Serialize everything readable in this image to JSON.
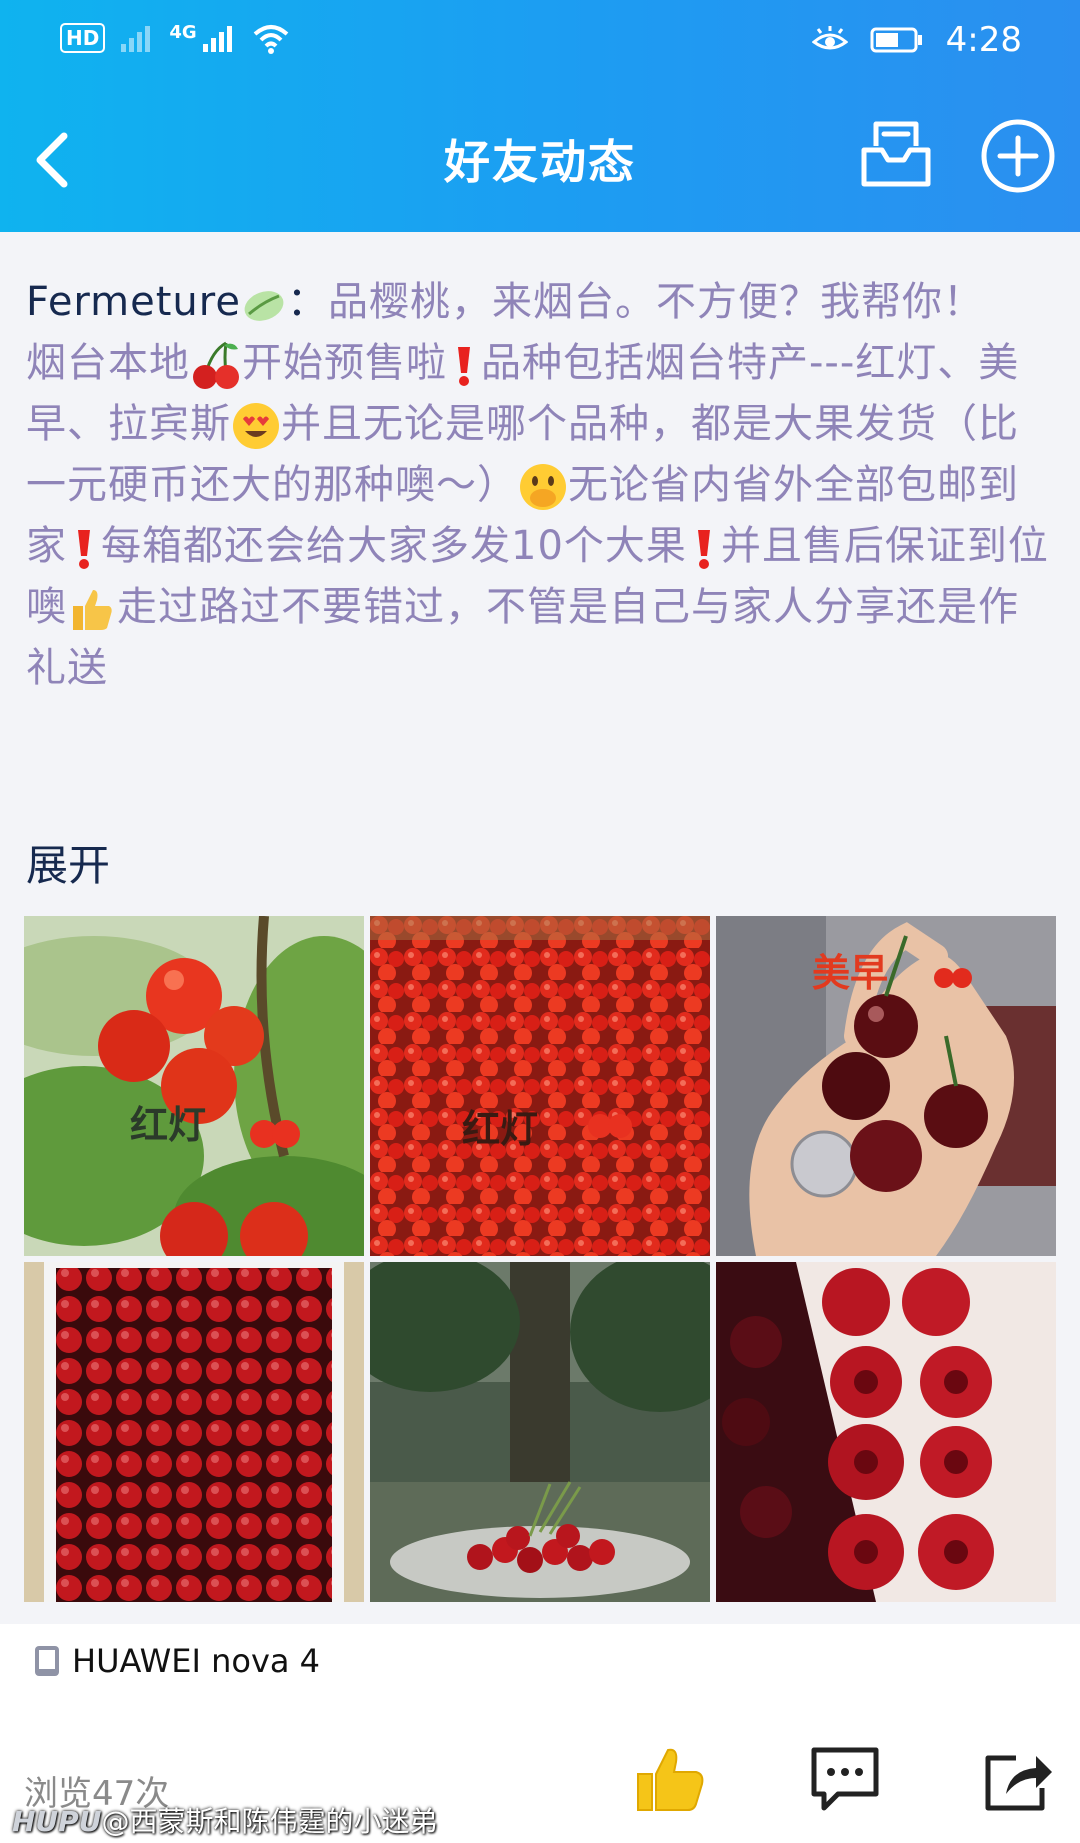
{
  "status_bar": {
    "hd_label": "HD",
    "network_label": "4G",
    "time": "4:28"
  },
  "nav": {
    "title": "好友动态"
  },
  "post": {
    "author": "Fermeture",
    "separator": "：",
    "text_1": "品樱桃，来烟台。不方便？我帮你！",
    "text_2": "烟台本地",
    "text_3": "开始预售啦",
    "text_4": "品种包括烟台特产---红灯、美早、拉宾斯",
    "text_5": "并且无论是哪个品种，都是大果发货（比一元硬币还大的那种噢～）",
    "text_6": "无论省内省外全部包邮到家",
    "text_7": "每箱都还会给大家多发10个大果",
    "text_8": "并且售后保证到位噢",
    "text_9": "走过路过不要错过，不管是自己与家人分享还是作礼送",
    "expand_label": "展开",
    "photos": [
      {
        "label": "红灯"
      },
      {
        "label": "红灯"
      },
      {
        "label": "美早"
      },
      {
        "label": ""
      },
      {
        "label": ""
      },
      {
        "label": ""
      }
    ]
  },
  "footer": {
    "device": "HUAWEI nova 4",
    "views": "浏览47次"
  },
  "watermark": {
    "brand": "HUPU",
    "text": "@西蒙斯和陈伟霆的小迷弟"
  },
  "icons": {
    "back": "chevron-left-icon",
    "inbox": "mail-tray-icon",
    "add": "plus-circle-icon",
    "like": "thumbs-up-icon",
    "comment": "comment-icon",
    "share": "share-icon",
    "phone": "phone-icon"
  },
  "colors": {
    "header_start": "#0fb3ef",
    "header_end": "#2b8ff0",
    "post_text": "#8f84b8",
    "author": "#16294f",
    "like_yellow": "#f5c518"
  }
}
